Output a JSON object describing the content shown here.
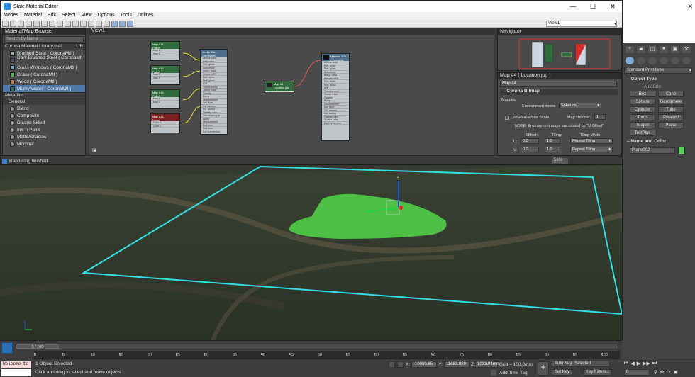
{
  "slate": {
    "title": "Slate Material Editor",
    "menu": [
      "Modes",
      "Material",
      "Edit",
      "Select",
      "View",
      "Options",
      "Tools",
      "Utilities"
    ],
    "view_select": "View1",
    "browser": {
      "title": "Material/Map Browser",
      "search_placeholder": "Search by Name ...",
      "library_group": "Corona Material Library.mat",
      "library_group_tag": "LIB",
      "library_items": [
        "Brushed Steel  ( CoronaMtl )",
        "Dark Brushed Steel  ( CoronaMtl )",
        "Glass Windows  ( CoronaMtl )",
        "Grass  ( CoronaMtl )",
        "Wood  ( CoronaMtl )",
        "Murky Water  ( CoronaMtl )"
      ],
      "materials_group": "Materials",
      "general_group": "General",
      "general_items": [
        "Blend",
        "Composite",
        "Double Sided",
        "Ink 'n Paint",
        "Matte/Shadow",
        "Morpher"
      ]
    },
    "view_tab": "View1",
    "graph": {
      "falloff_nodes": [
        {
          "title": "Map #14",
          "sub": "Falloff",
          "slots": [
            "Color 1",
            "Map 1",
            "Color 2",
            "Map 2"
          ]
        },
        {
          "title": "Map #15",
          "sub": "Falloff",
          "slots": [
            "Color 1",
            "Map 1",
            "Color 2",
            "Map 2"
          ]
        },
        {
          "title": "Map #16",
          "sub": "Falloff",
          "slots": [
            "Color 1",
            "Map 1",
            "Color 2",
            "Map 2"
          ]
        },
        {
          "title": "Map #13",
          "sub": "Noise",
          "slots": [
            "Color 1",
            "Map 1",
            "Color 2",
            "Map 2"
          ]
        }
      ],
      "murky_node": {
        "title": "Murky Wa...",
        "sub": "CoronaMtl",
        "slots": [
          "Diffuse color",
          "Refl. color",
          "Refl. gloss",
          "Anisotropy",
          "Aniso. rotat.",
          "Fresnel IOR",
          "Refr. color",
          "Refr. gloss",
          "IOR",
          "Translucency",
          "Transl. fract.",
          "Opacity",
          "Bump",
          "Displacement",
          "Self illum.",
          "Vol. absorp.",
          "Vol. scatter",
          "Opacity color",
          "Translucency fr.",
          "Bump",
          "Displacement",
          "Refl. env.",
          "Refr. env.",
          "Opacity clip",
          "Scatter color",
          "Ext Connection"
        ]
      },
      "location_node": {
        "title": "Map #4",
        "sub": "Location.jpg"
      },
      "mtl_node": {
        "title": "Material #25",
        "sub": "CoronaMtl",
        "slots": [
          "Diffuse color",
          "Refl. color",
          "Refl. gloss",
          "Anisotropy",
          "Aniso. rotat.",
          "Fresnel IOR",
          "Refr. color",
          "Refr. gloss",
          "IOR",
          "Translucency",
          "Transl. fract.",
          "Opacity",
          "Bump",
          "Displacement",
          "Self illum.",
          "Vol. absorp.",
          "Vol. scatter",
          "Opacity color",
          "Scatter color",
          "Ext Connection"
        ]
      }
    },
    "navigator": {
      "title": "Navigator"
    },
    "params": {
      "title": "Map #4  ( Location.jpg )",
      "map_name": "Map #4",
      "rollout": "Corona Bitmap",
      "mapping_label": "Mapping",
      "env_mode_label": "Environment mode:",
      "env_mode_value": "Spherical",
      "realworld_label": "Use Real-World Scale",
      "map_channel_label": "Map channel:",
      "map_channel_value": "1",
      "note": "NOTE: Environment maps are rotated by \"U Offset\"",
      "offset_label": "Offset:",
      "tiling_label": "Tiling:",
      "tiling_mode_label": "Tiling Mode:",
      "u_label": "U:",
      "v_label": "V:",
      "u_offset": "0.0",
      "v_offset": "0.0",
      "u_tiling": "1.0",
      "v_tiling": "1.0",
      "u_mode": "Repeat Tiling",
      "v_mode": "Repeat Tiling"
    },
    "status": "Rendering finished",
    "zoom": "56%"
  },
  "command_panel": {
    "category": "Standard Primitives",
    "object_type_title": "Object Type",
    "autogrid": "AutoGrid",
    "object_buttons": [
      "Box",
      "Cone",
      "Sphere",
      "GeoSphere",
      "Cylinder",
      "Tube",
      "Torus",
      "Pyramid",
      "Teapot",
      "Plane",
      "TextPlus"
    ],
    "name_color_title": "Name and Color",
    "object_name": "Plane002",
    "object_color": "#5ad45a"
  },
  "timeline": {
    "frame_label": "0 / 100",
    "ticks": [
      "0",
      "5",
      "10",
      "15",
      "20",
      "25",
      "30",
      "35",
      "40",
      "45",
      "50",
      "55",
      "60",
      "65",
      "70",
      "75",
      "80",
      "85",
      "90",
      "95",
      "100"
    ]
  },
  "statusbar": {
    "maxscript": "Welcome to",
    "selection": "1 Object Selected",
    "hint": "Click and drag to select and move objects",
    "x_label": "X:",
    "x_value": "-10080.85",
    "y_label": "Y:",
    "y_value": "11683.989",
    "z_label": "Z:",
    "z_value": "1033.94mm",
    "grid": "Grid = 100.0mm",
    "add_time_tag": "Add Time Tag",
    "auto_key": "Auto Key",
    "set_key": "Set Key",
    "selected": "Selected",
    "key_filters": "Key Filters...",
    "frame_field": "0"
  },
  "colors": {
    "grass": "#4cbf44",
    "selection_box": "#33e0e6",
    "accent": "#4f79a8"
  }
}
